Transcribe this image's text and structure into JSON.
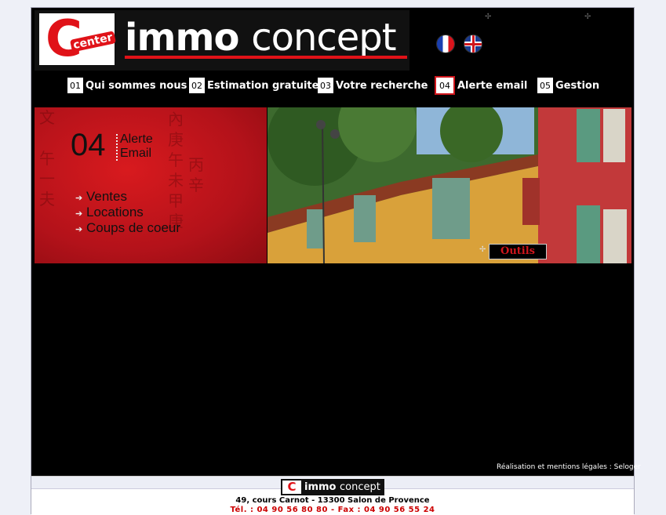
{
  "header": {
    "logo_small_text": "center",
    "logo_word": "immo",
    "logo_word2": "concept",
    "languages": [
      {
        "name": "Français",
        "icon": "french-flag-icon"
      },
      {
        "name": "English",
        "icon": "uk-flag-icon"
      }
    ]
  },
  "nav": [
    {
      "num": "01",
      "label": "Qui sommes nous",
      "active": false
    },
    {
      "num": "02",
      "label": "Estimation gratuite",
      "active": false
    },
    {
      "num": "03",
      "label": "Votre recherche",
      "active": false
    },
    {
      "num": "04",
      "label": "Alerte email",
      "active": true
    },
    {
      "num": "05",
      "label": "Gestion",
      "active": false
    }
  ],
  "section": {
    "number": "04",
    "title_line1": "Alerte",
    "title_line2": "Email",
    "links": [
      "Ventes",
      "Locations",
      "Coups de coeur"
    ]
  },
  "tools_button": "Outils",
  "credits": "Réalisation et mentions légales : Seloger",
  "footer": {
    "logo_word": "immo",
    "logo_word2": "concept",
    "address": "49, cours Carnot - 13300 Salon de Provence",
    "phone": "Tél. : 04 90 56 80 80 - Fax : 04 90 56 55 24"
  },
  "colors": {
    "accent": "#d0161c",
    "background": "#000000",
    "page": "#eef0f7"
  }
}
